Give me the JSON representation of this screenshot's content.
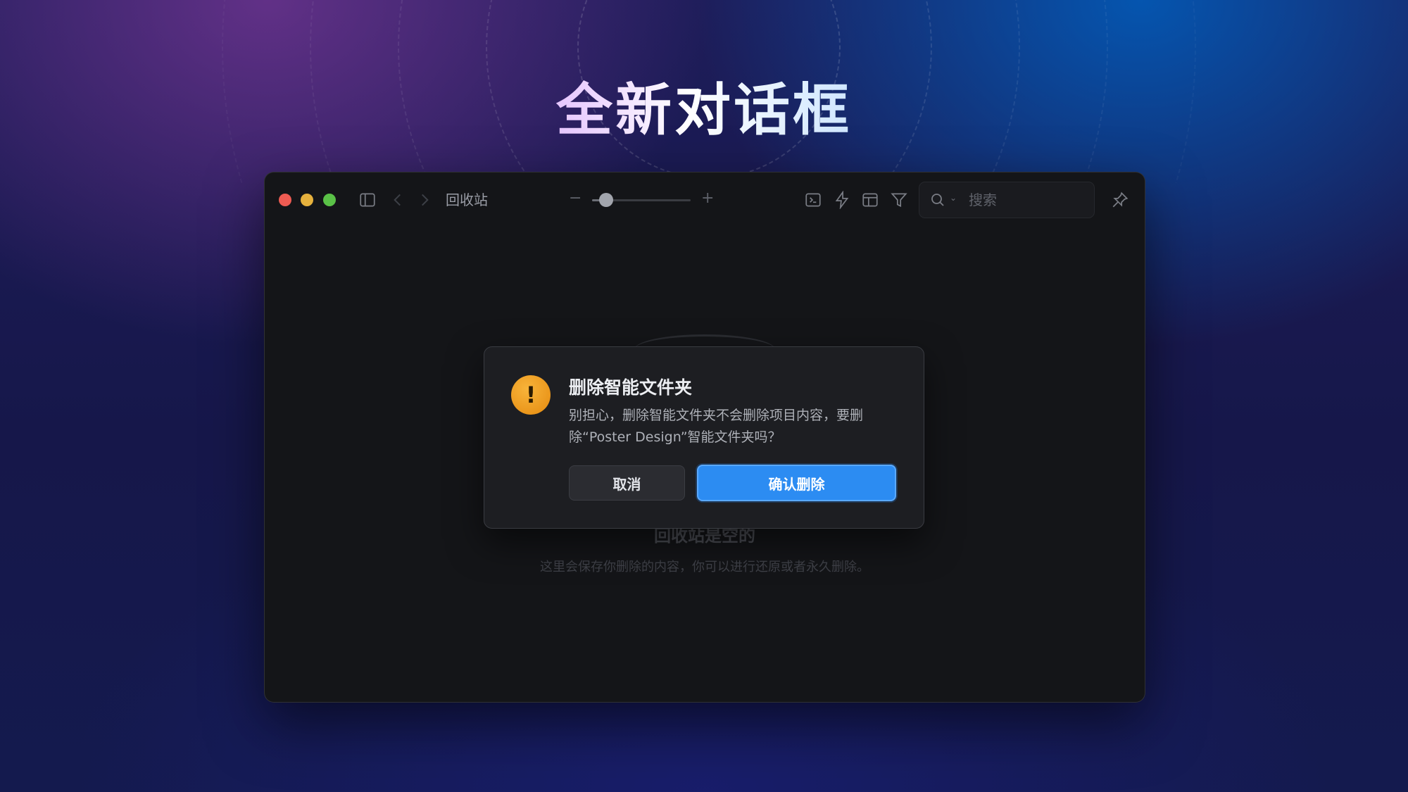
{
  "headline": "全新对话框",
  "window": {
    "breadcrumb": "回收站",
    "zoom": {
      "minus": "−",
      "plus": "+",
      "level": 0.12
    },
    "search": {
      "placeholder": "搜索"
    },
    "toolbar_icons": [
      "sidebar-toggle-icon",
      "chevron-left-icon",
      "chevron-right-icon",
      "terminal-icon",
      "bolt-icon",
      "layout-icon",
      "filter-icon",
      "search-icon",
      "pin-icon"
    ],
    "empty_state": {
      "title": "回收站是空的",
      "description": "这里会保存你删除的内容，你可以进行还原或者永久删除。"
    }
  },
  "dialog": {
    "icon": "!",
    "title": "删除智能文件夹",
    "message": "别担心，删除智能文件夹不会删除项目内容，要删除“Poster Design”智能文件夹吗？",
    "cancel_label": "取消",
    "confirm_label": "确认删除"
  },
  "colors": {
    "accent": "#2c8cf2",
    "warning": "#f0a020",
    "close": "#ee5b52",
    "minimize": "#e6b13d",
    "maximize": "#5ac147"
  }
}
